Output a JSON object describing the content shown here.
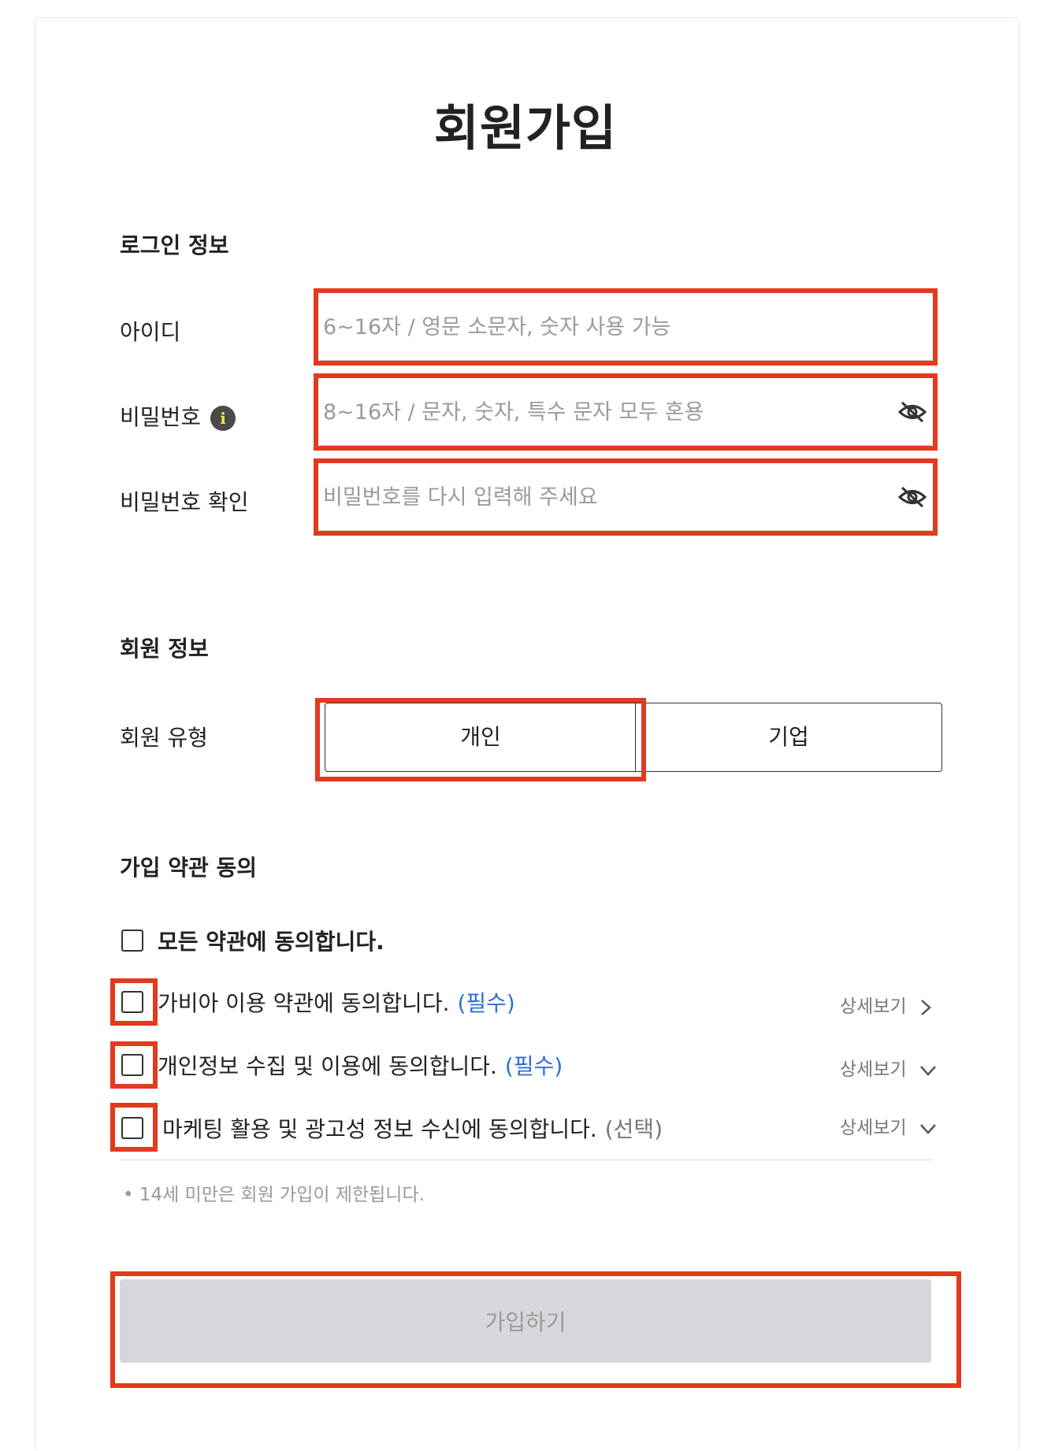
{
  "page": {
    "title": "회원가입"
  },
  "login_section": {
    "heading": "로그인 정보",
    "id": {
      "label": "아이디",
      "placeholder": "6~16자 / 영문 소문자, 숫자 사용 가능"
    },
    "password": {
      "label": "비밀번호",
      "placeholder": "8~16자 / 문자, 숫자, 특수 문자 모두 혼용",
      "info_icon": "info-icon",
      "visibility_icon": "eye-slash-icon"
    },
    "password_confirm": {
      "label": "비밀번호 확인",
      "placeholder": "비밀번호를 다시 입력해 주세요",
      "visibility_icon": "eye-slash-icon"
    }
  },
  "member_section": {
    "heading": "회원 정보",
    "type_label": "회원 유형",
    "options": [
      "개인",
      "기업"
    ],
    "selected": "개인"
  },
  "terms_section": {
    "heading": "가입 약관 동의",
    "agree_all": "모든 약관에 동의합니다.",
    "items": [
      {
        "text": "가비아 이용 약관에 동의합니다.",
        "tag": "(필수)",
        "detail": "상세보기",
        "chevron": "chevron-right-icon"
      },
      {
        "text": "개인정보 수집 및 이용에 동의합니다.",
        "tag": "(필수)",
        "detail": "상세보기",
        "chevron": "chevron-down-icon"
      },
      {
        "text": "마케팅 활용 및 광고성 정보 수신에 동의합니다.",
        "tag": "(선택)",
        "detail": "상세보기",
        "chevron": "chevron-down-icon"
      }
    ],
    "note": "• 14세 미만은 회원 가입이 제한됩니다."
  },
  "submit": {
    "label": "가입하기"
  },
  "colors": {
    "highlight": "#e3391f",
    "required": "#2f6fd6",
    "submit_bg": "#d5d7dc"
  }
}
